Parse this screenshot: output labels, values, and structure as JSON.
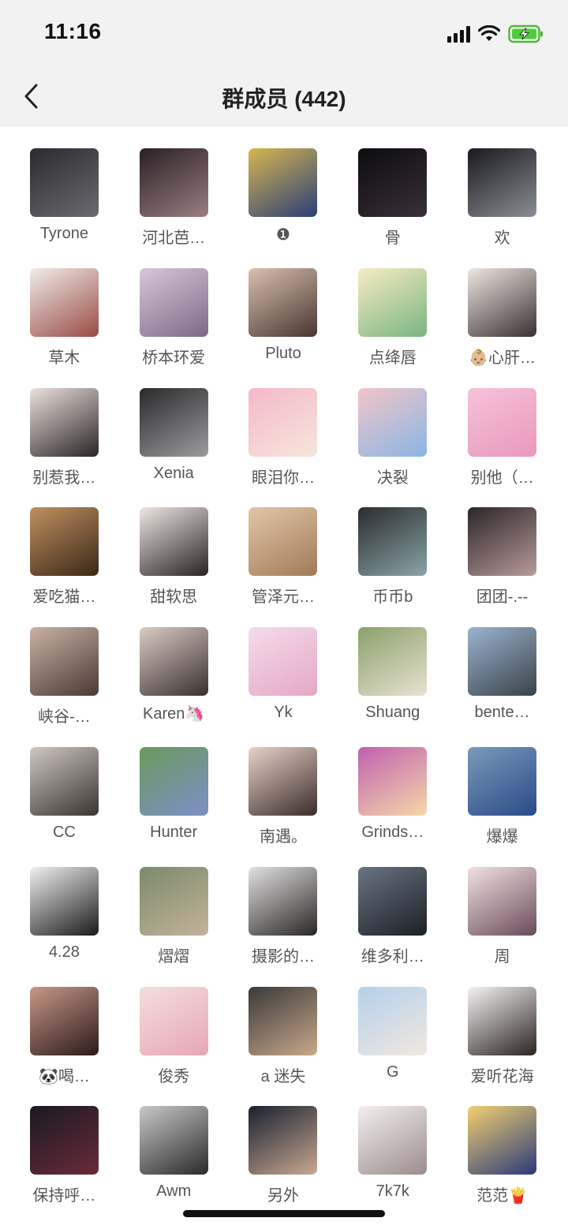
{
  "status_bar": {
    "time": "11:16"
  },
  "header": {
    "title": "群成员 (442)"
  },
  "members": [
    {
      "name": "Tyrone",
      "colors": [
        "#2b2b2f",
        "#6a6a70"
      ]
    },
    {
      "name": "河北芭…",
      "colors": [
        "#2a2024",
        "#9a7f82"
      ]
    },
    {
      "name": "❶",
      "colors": [
        "#d6b650",
        "#2a3e78"
      ]
    },
    {
      "name": "骨",
      "colors": [
        "#0c0c10",
        "#3a3038"
      ]
    },
    {
      "name": "欢",
      "colors": [
        "#1a1a1e",
        "#8a8e94"
      ]
    },
    {
      "name": "草木",
      "colors": [
        "#f0ece8",
        "#9a4a44"
      ]
    },
    {
      "name": "桥本环爱",
      "colors": [
        "#d8c6d8",
        "#7a6a86"
      ]
    },
    {
      "name": "Pluto",
      "colors": [
        "#d8c0b0",
        "#4a3630"
      ]
    },
    {
      "name": "点绛唇",
      "colors": [
        "#f6ecc2",
        "#7ab482"
      ]
    },
    {
      "name": "👶🏼心肝…",
      "colors": [
        "#efe6e2",
        "#3a3032"
      ]
    },
    {
      "name": "别惹我…",
      "colors": [
        "#ebe1dd",
        "#2c2426"
      ]
    },
    {
      "name": "Xenia",
      "colors": [
        "#2a2a2c",
        "#9c9c9e"
      ]
    },
    {
      "name": "眼泪你…",
      "colors": [
        "#f4b8c8",
        "#f6e6dc"
      ]
    },
    {
      "name": "决裂",
      "colors": [
        "#f2c4c8",
        "#8ab6e4"
      ]
    },
    {
      "name": "别他（…",
      "colors": [
        "#f6c2da",
        "#e898bc"
      ]
    },
    {
      "name": "爱吃猫…",
      "colors": [
        "#c09060",
        "#3a2818"
      ]
    },
    {
      "name": "甜软思",
      "colors": [
        "#eee6e2",
        "#2a2224"
      ]
    },
    {
      "name": "管泽元…",
      "colors": [
        "#e2c6a6",
        "#a07a58"
      ]
    },
    {
      "name": "币币b",
      "colors": [
        "#2a2c2e",
        "#8aa4a8"
      ]
    },
    {
      "name": "团团-.--",
      "colors": [
        "#2c2628",
        "#b89a9a"
      ]
    },
    {
      "name": "峡谷-…",
      "colors": [
        "#c8b2a4",
        "#4a3a34"
      ]
    },
    {
      "name": "Karen🦄",
      "colors": [
        "#d8ccc4",
        "#3a3030"
      ]
    },
    {
      "name": "Yk",
      "colors": [
        "#f4dceb",
        "#e6a6c6"
      ]
    },
    {
      "name": "Shuang",
      "colors": [
        "#8aa06a",
        "#e8e2d2"
      ]
    },
    {
      "name": "bente…",
      "colors": [
        "#9ab4d0",
        "#3a4248"
      ]
    },
    {
      "name": "CC",
      "colors": [
        "#cfc7c1",
        "#3a3432"
      ]
    },
    {
      "name": "Hunter",
      "colors": [
        "#6a9a5c",
        "#7e8ec8"
      ]
    },
    {
      "name": "南遇。",
      "colors": [
        "#e8d2c8",
        "#3a2c2a"
      ]
    },
    {
      "name": "Grinds…",
      "colors": [
        "#c060b0",
        "#f4d8a8"
      ]
    },
    {
      "name": "爆爆",
      "colors": [
        "#7a9ab8",
        "#2a4a8a"
      ]
    },
    {
      "name": "4.28",
      "colors": [
        "#f0f0f0",
        "#1a1a1a"
      ]
    },
    {
      "name": "熠熠",
      "colors": [
        "#7a8a6a",
        "#c4b29c"
      ]
    },
    {
      "name": "摄影的…",
      "colors": [
        "#e2e0e0",
        "#2a2626"
      ]
    },
    {
      "name": "维多利…",
      "colors": [
        "#6a7482",
        "#1c2026"
      ]
    },
    {
      "name": "周",
      "colors": [
        "#f0e2e0",
        "#6a4a5a"
      ]
    },
    {
      "name": "🐼喝…",
      "colors": [
        "#c89888",
        "#2a1a1a"
      ]
    },
    {
      "name": "俊秀",
      "colors": [
        "#f2dede",
        "#e8a6b4"
      ]
    },
    {
      "name": "a 迷失",
      "colors": [
        "#3a3a3a",
        "#c8a88a"
      ]
    },
    {
      "name": "G",
      "colors": [
        "#b4d0ea",
        "#f0e8e0"
      ]
    },
    {
      "name": "爱听花海",
      "colors": [
        "#f4f2f2",
        "#2a2422"
      ]
    },
    {
      "name": "保持呼…",
      "colors": [
        "#1a1a22",
        "#6a2a3a"
      ]
    },
    {
      "name": "Awm",
      "colors": [
        "#c8c8c8",
        "#2a2a2a"
      ]
    },
    {
      "name": "另外",
      "colors": [
        "#1a2030",
        "#c8a890"
      ]
    },
    {
      "name": "7k7k",
      "colors": [
        "#f4eeee",
        "#9a8c8c"
      ]
    },
    {
      "name": "范范🍟",
      "colors": [
        "#f2d070",
        "#2a3a7a"
      ]
    }
  ]
}
